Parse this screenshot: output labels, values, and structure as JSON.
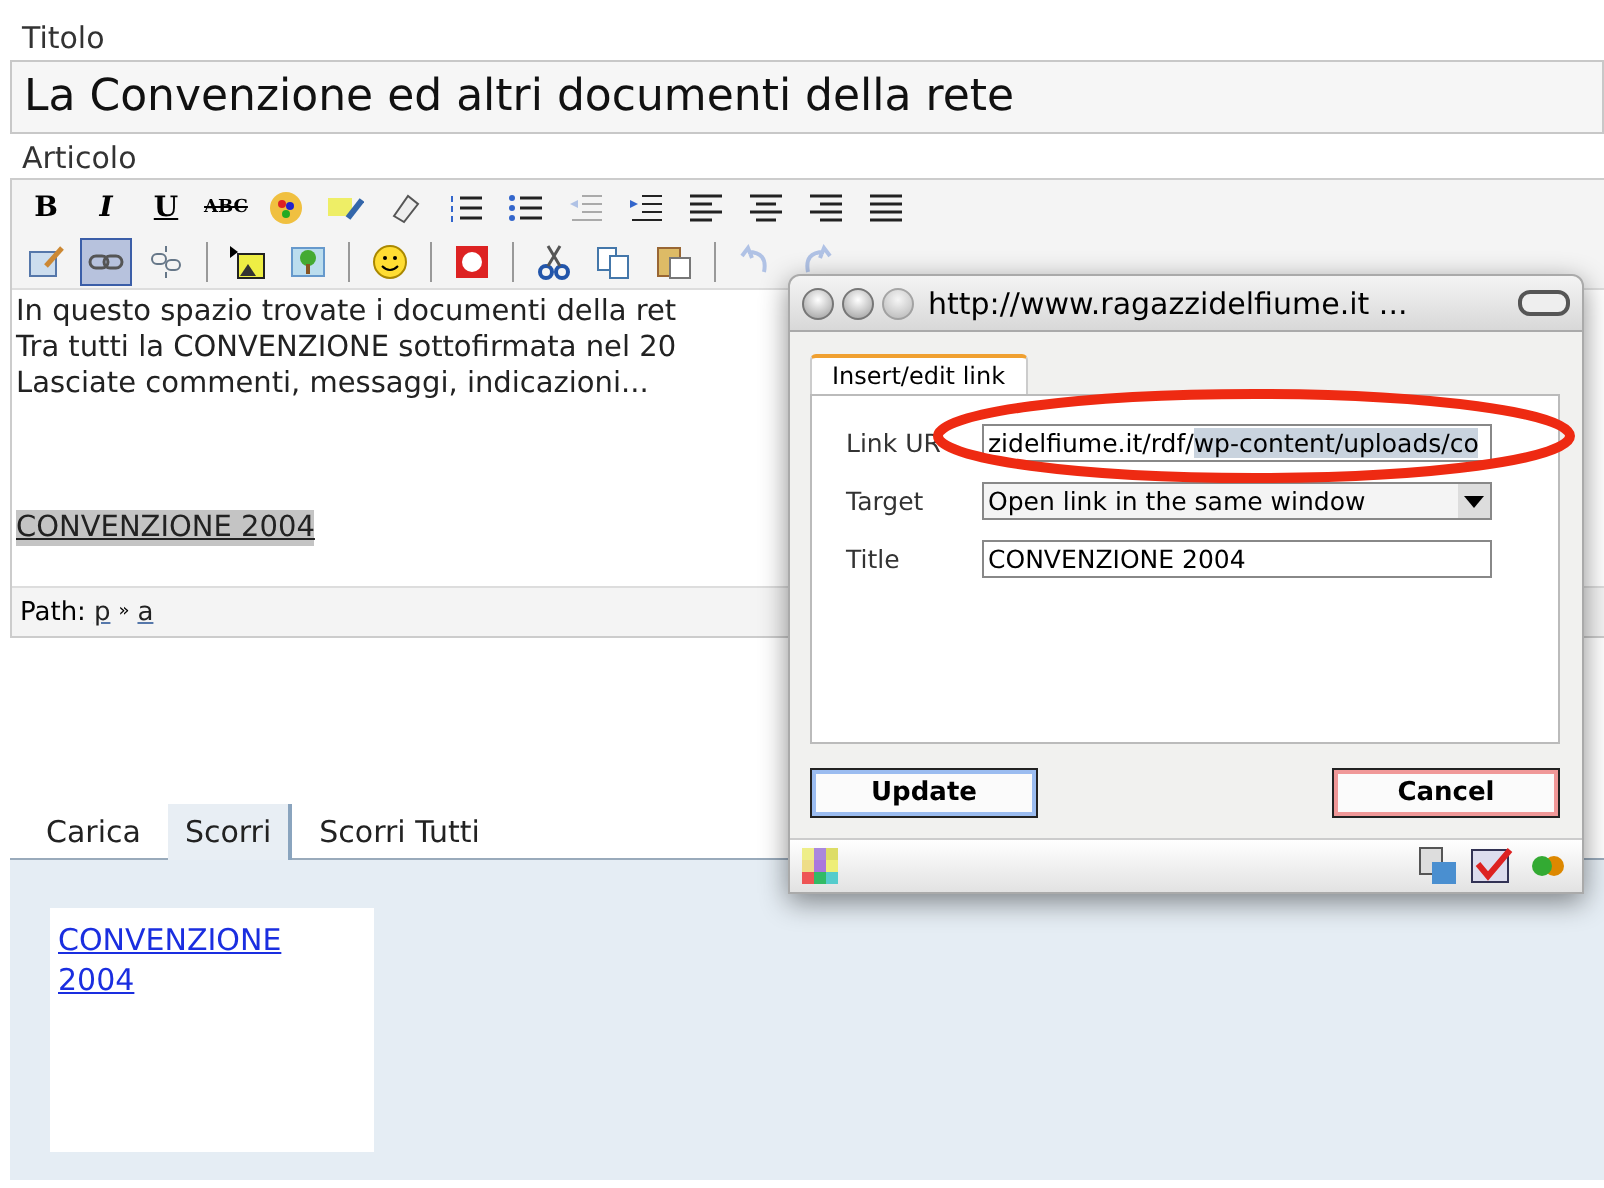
{
  "title_label": "Titolo",
  "title_value": "La Convenzione ed altri documenti della rete",
  "article_label": "Articolo",
  "toolbar_rows": [
    [
      {
        "kind": "text",
        "label": "B"
      },
      {
        "kind": "text",
        "label": "I"
      },
      {
        "kind": "text",
        "label": "U"
      },
      {
        "kind": "text",
        "label": "ABC"
      },
      {
        "kind": "icon"
      },
      {
        "kind": "icon"
      },
      {
        "kind": "icon"
      },
      {
        "kind": "icon"
      },
      {
        "kind": "icon"
      },
      {
        "kind": "icon",
        "disabled": true
      },
      {
        "kind": "icon"
      },
      {
        "kind": "icon"
      },
      {
        "kind": "icon"
      },
      {
        "kind": "icon"
      },
      {
        "kind": "icon"
      }
    ],
    [
      {
        "kind": "icon"
      },
      {
        "kind": "icon",
        "selected": true
      },
      {
        "kind": "icon"
      },
      {
        "kind": "separator"
      },
      {
        "kind": "icon"
      },
      {
        "kind": "icon"
      },
      {
        "kind": "separator"
      },
      {
        "kind": "icon"
      },
      {
        "kind": "separator"
      },
      {
        "kind": "icon"
      },
      {
        "kind": "separator"
      },
      {
        "kind": "icon"
      },
      {
        "kind": "icon"
      },
      {
        "kind": "icon"
      },
      {
        "kind": "separator"
      },
      {
        "kind": "icon",
        "disabled": true
      },
      {
        "kind": "icon",
        "disabled": true
      }
    ]
  ],
  "editor_lines": [
    "In questo spazio trovate i documenti della ret",
    "Tra tutti la CONVENZIONE sottofirmata nel 20",
    "Lasciate commenti, messaggi, indicazioni..."
  ],
  "editor_link": {
    "text": "CONVENZIONE 2004",
    "selected": true
  },
  "path": {
    "label": "Path:",
    "items": [
      "p",
      "a"
    ],
    "separator": "»"
  },
  "tabs": [
    {
      "label": "Carica",
      "selected": false
    },
    {
      "label": "Scorri",
      "selected": true
    },
    {
      "label": "Scorri Tutti",
      "selected": false
    }
  ],
  "file_link": "CONVENZIONE 2004",
  "dialog": {
    "title": "http://www.ragazzidelfiume.it ...",
    "tab": "Insert/edit link",
    "fields": [
      {
        "kind": "text",
        "label": "Link UR",
        "value": "zidelfiume.it/rdf/",
        "selected_value": "wp-content/uploads/co"
      },
      {
        "kind": "select",
        "label": "Target",
        "value": "Open link in the same window"
      },
      {
        "kind": "text",
        "label": "Title",
        "value": "CONVENZIONE 2004"
      }
    ],
    "buttons": [
      {
        "label": "Update",
        "kind": "primary"
      },
      {
        "label": "Cancel",
        "kind": "cancel"
      }
    ],
    "annotation": {
      "color": "#ee2a12"
    }
  }
}
